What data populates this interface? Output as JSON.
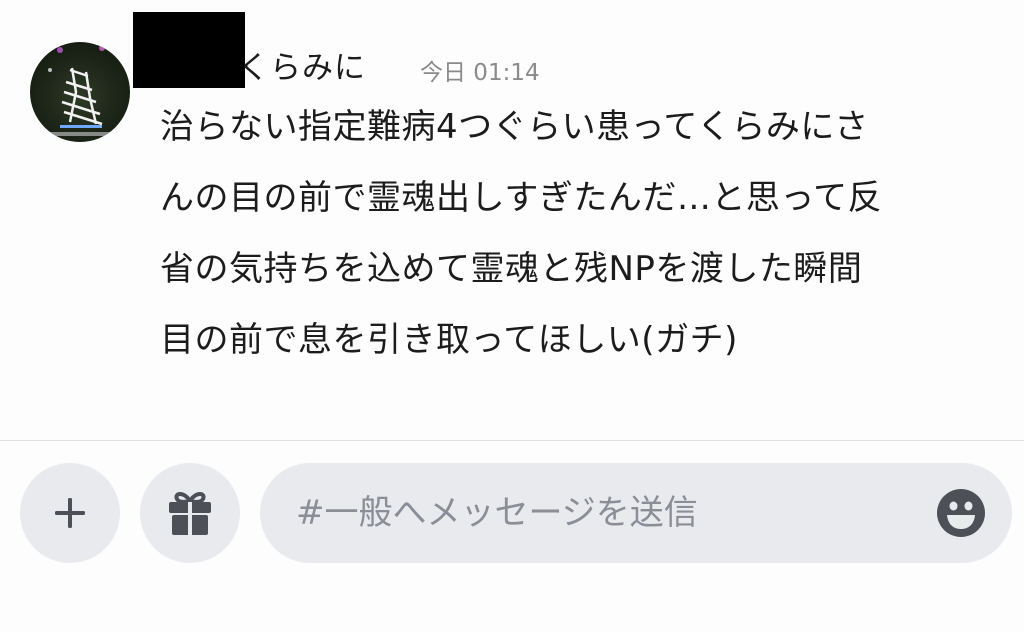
{
  "message": {
    "author": "くらみに",
    "timestamp": "今日 01:14",
    "lines": [
      "治らない指定難病4つぐらい患ってくらみにさ",
      "んの目の前で霊魂出しすぎたんだ…と思って反",
      "省の気持ちを込めて霊魂と残NPを渡した瞬間",
      "目の前で息を引き取ってほしい(ガチ)"
    ],
    "avatar_icon": "user-avatar"
  },
  "composer": {
    "add_icon": "plus-icon",
    "gift_icon": "gift-icon",
    "placeholder": "#一般へメッセージを送信",
    "emoji_icon": "smiley-face-icon"
  },
  "colors": {
    "background": "#fdfdfd",
    "button_bg": "#e9eaee",
    "icon": "#4e5058",
    "placeholder": "#8b8e96",
    "timestamp": "#8a8a8a",
    "text": "#1c1c1c"
  }
}
